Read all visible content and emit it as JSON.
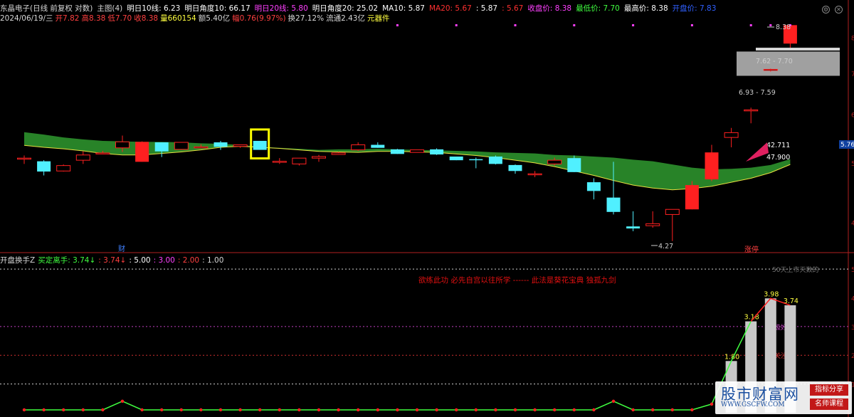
{
  "header": {
    "items": [
      {
        "text": "东晶电子(日线 前复权 对数)",
        "color": "#d8d8d8"
      },
      {
        "text": "主图(4)",
        "color": "#d8d8d8"
      },
      {
        "text": "明日10线: 6.23",
        "color": "#ffffff"
      },
      {
        "text": "明日角度10: 66.17",
        "color": "#ffffff"
      },
      {
        "text": "明日20线: 5.80",
        "color": "#ff40ff"
      },
      {
        "text": "明日角度20: 25.02",
        "color": "#ffffff"
      },
      {
        "text": "MA10: 5.87",
        "color": "#ffffff"
      },
      {
        "text": "MA20: 5.67",
        "color": "#ff3030"
      },
      {
        "text": ": 5.87",
        "color": "#ffffff"
      },
      {
        "text": ": 5.67",
        "color": "#ff3030"
      },
      {
        "text": "收盘价: 8.38",
        "color": "#ff40ff"
      },
      {
        "text": "最低价: 7.70",
        "color": "#40ff40"
      },
      {
        "text": "最高价: 8.38",
        "color": "#ffffff"
      },
      {
        "text": "开盘价: 7.83",
        "color": "#3060ff"
      }
    ],
    "line2": [
      {
        "text": "2024/06/19/三",
        "color": "#d8d8d8"
      },
      {
        "text": "开7.82",
        "color": "#ff4040"
      },
      {
        "text": "高8.38",
        "color": "#ff4040"
      },
      {
        "text": "低7.70",
        "color": "#ff4040"
      },
      {
        "text": "收8.38",
        "color": "#ff4040"
      },
      {
        "text": "量660154",
        "color": "#ffff40"
      },
      {
        "text": "额5.40亿",
        "color": "#d8d8d8"
      },
      {
        "text": "幅0.76(9.97%)",
        "color": "#ff4040"
      },
      {
        "text": "换27.12%",
        "color": "#d8d8d8"
      },
      {
        "text": "流通2.43亿",
        "color": "#d8d8d8"
      },
      {
        "text": "元器件",
        "color": "#ffff40"
      }
    ]
  },
  "indicator_header": [
    {
      "text": "开盘换手Z",
      "color": "#d8d8d8"
    },
    {
      "text": "买定离手: 3.74↓",
      "color": "#40ff40"
    },
    {
      "text": ": 3.74↓",
      "color": "#ff4040"
    },
    {
      "text": ": 5.00",
      "color": "#ffffff"
    },
    {
      "text": ": 3.00",
      "color": "#ff40ff"
    },
    {
      "text": ": 2.00",
      "color": "#ff4040"
    },
    {
      "text": ": 1.00",
      "color": "#d8d8d8"
    }
  ],
  "banner": "欲练此功 必先自宫以往所学 ------ 此法是葵花宝典 独孤九剑",
  "watermark": {
    "title": "股市财富网",
    "url": "WWW.GSCFW.COM",
    "tag1": "指标分享",
    "tag2": "名师课程"
  },
  "labels": {
    "cai": "财",
    "zhangting": "涨停",
    "low_price": "4.27",
    "high_price": "8.38",
    "range1": "6.93 - 7.59",
    "range2": "7.62 - 7.70",
    "val1": "42.711",
    "val2": "47.900",
    "price_tag": "5.76",
    "top_line": "50天上市天数的",
    "jihao": "极好",
    "guanzhu": "关注"
  },
  "colors": {
    "up": "#ff2020",
    "down": "#50f0ff",
    "band": "#2a8a2a",
    "zone": "#a0a0a0",
    "bar": "#c8c8c8",
    "line": "#40ff40",
    "dot": "#ff2020"
  },
  "chart_data": [
    {
      "type": "candlestick",
      "title": "东晶电子(日线 前复权 对数)",
      "ylim": [
        4,
        8.4
      ],
      "y_ticks": [
        4,
        5,
        6,
        7,
        8
      ],
      "candles": [
        {
          "o": 5.09,
          "h": 5.14,
          "l": 4.98,
          "c": 5.09
        },
        {
          "o": 5.03,
          "h": 5.05,
          "l": 4.77,
          "c": 4.84
        },
        {
          "o": 4.85,
          "h": 4.97,
          "l": 4.84,
          "c": 4.95
        },
        {
          "o": 5.05,
          "h": 5.22,
          "l": 4.98,
          "c": 5.15
        },
        {
          "o": 5.19,
          "h": 5.23,
          "l": 5.18,
          "c": 5.19
        },
        {
          "o": 5.29,
          "h": 5.54,
          "l": 5.21,
          "c": 5.41
        },
        {
          "o": 5.02,
          "h": 5.42,
          "l": 5.02,
          "c": 5.41
        },
        {
          "o": 5.4,
          "h": 5.4,
          "l": 5.11,
          "c": 5.22
        },
        {
          "o": 5.26,
          "h": 5.4,
          "l": 5.25,
          "c": 5.4
        },
        {
          "o": 5.31,
          "h": 5.36,
          "l": 5.28,
          "c": 5.31
        },
        {
          "o": 5.4,
          "h": 5.43,
          "l": 5.25,
          "c": 5.31
        },
        {
          "o": 5.32,
          "h": 5.35,
          "l": 5.29,
          "c": 5.35
        },
        {
          "o": 5.43,
          "h": 5.43,
          "l": 5.25,
          "c": 5.25
        },
        {
          "o": 5.03,
          "h": 5.09,
          "l": 4.98,
          "c": 5.03
        },
        {
          "o": 4.98,
          "h": 5.09,
          "l": 4.95,
          "c": 5.09
        },
        {
          "o": 5.09,
          "h": 5.15,
          "l": 5.02,
          "c": 5.12
        },
        {
          "o": 5.16,
          "h": 5.21,
          "l": 5.16,
          "c": 5.19
        },
        {
          "o": 5.25,
          "h": 5.4,
          "l": 5.23,
          "c": 5.35
        },
        {
          "o": 5.35,
          "h": 5.4,
          "l": 5.29,
          "c": 5.29
        },
        {
          "o": 5.26,
          "h": 5.27,
          "l": 5.17,
          "c": 5.17
        },
        {
          "o": 5.2,
          "h": 5.25,
          "l": 5.2,
          "c": 5.25
        },
        {
          "o": 5.26,
          "h": 5.28,
          "l": 5.15,
          "c": 5.16
        },
        {
          "o": 5.12,
          "h": 5.12,
          "l": 5.05,
          "c": 5.05
        },
        {
          "o": 5.07,
          "h": 5.1,
          "l": 4.9,
          "c": 5.05
        },
        {
          "o": 5.12,
          "h": 5.14,
          "l": 4.97,
          "c": 4.98
        },
        {
          "o": 4.96,
          "h": 4.97,
          "l": 4.8,
          "c": 4.85
        },
        {
          "o": 4.79,
          "h": 4.85,
          "l": 4.74,
          "c": 4.8
        },
        {
          "o": 4.98,
          "h": 5.1,
          "l": 4.95,
          "c": 5.05
        },
        {
          "o": 5.09,
          "h": 5.14,
          "l": 4.83,
          "c": 4.83
        },
        {
          "o": 4.65,
          "h": 4.72,
          "l": 4.36,
          "c": 4.5
        },
        {
          "o": 4.39,
          "h": 5.02,
          "l": 4.12,
          "c": 4.16
        },
        {
          "o": 3.94,
          "h": 4.17,
          "l": 3.87,
          "c": 3.91
        },
        {
          "o": 3.95,
          "h": 4.17,
          "l": 3.92,
          "c": 3.98
        },
        {
          "o": 4.12,
          "h": 4.16,
          "l": 3.73,
          "c": 4.2
        },
        {
          "o": 4.2,
          "h": 4.67,
          "l": 4.2,
          "c": 4.6
        },
        {
          "o": 4.7,
          "h": 5.35,
          "l": 4.67,
          "c": 5.2
        },
        {
          "o": 5.5,
          "h": 5.7,
          "l": 5.3,
          "c": 5.6
        },
        {
          "o": 6.1,
          "h": 6.15,
          "l": 5.8,
          "c": 6.1
        },
        {
          "o": 7.08,
          "h": 7.12,
          "l": 7.04,
          "c": 7.1
        },
        {
          "o": 7.82,
          "h": 8.38,
          "l": 7.7,
          "c": 8.38
        }
      ],
      "band_upper": [
        5.61,
        5.56,
        5.5,
        5.46,
        5.43,
        5.42,
        5.41,
        5.41,
        5.4,
        5.38,
        5.37,
        5.35,
        5.31,
        5.29,
        5.27,
        5.25,
        5.26,
        5.26,
        5.27,
        5.26,
        5.25,
        5.24,
        5.23,
        5.22,
        5.2,
        5.19,
        5.18,
        5.15,
        5.14,
        5.12,
        5.1,
        5.06,
        5.03,
        4.97,
        4.91,
        4.88,
        4.89,
        4.91,
        4.96,
        5.07
      ],
      "band_lower": [
        5.34,
        5.3,
        5.27,
        5.23,
        5.18,
        5.15,
        5.15,
        5.18,
        5.21,
        5.25,
        5.3,
        5.32,
        5.3,
        5.28,
        5.25,
        5.22,
        5.21,
        5.2,
        5.22,
        5.22,
        5.21,
        5.2,
        5.17,
        5.14,
        5.1,
        5.05,
        5.0,
        4.93,
        4.85,
        4.77,
        4.68,
        4.6,
        4.55,
        4.52,
        4.54,
        4.58,
        4.65,
        4.72,
        4.82,
        4.97
      ],
      "top_dots": [
        19,
        22,
        25,
        28,
        31,
        34,
        37,
        38,
        39
      ],
      "highlight_index": 12,
      "zone_1": [
        6.93,
        7.59
      ],
      "zone_2": [
        7.62,
        7.7
      ]
    },
    {
      "type": "bar+line",
      "ylim": [
        0,
        5.2
      ],
      "y_ticks": [
        1,
        2,
        3,
        4,
        5
      ],
      "ref_lines": [
        {
          "value": 5.0,
          "color": "#d0d0d0"
        },
        {
          "value": 3.0,
          "color": "#c040c0"
        },
        {
          "value": 2.0,
          "color": "#d03030"
        },
        {
          "value": 1.0,
          "color": "#d0d0d0"
        }
      ],
      "bars": [
        {
          "index": 36,
          "value": 1.8
        },
        {
          "index": 37,
          "value": 3.18
        },
        {
          "index": 38,
          "value": 3.98
        },
        {
          "index": 39,
          "value": 3.74
        }
      ],
      "line": [
        0.1,
        0.1,
        0.1,
        0.1,
        0.1,
        0.4,
        0.1,
        0.1,
        0.1,
        0.1,
        0.1,
        0.1,
        0.1,
        0.1,
        0.1,
        0.1,
        0.1,
        0.1,
        0.1,
        0.1,
        0.1,
        0.1,
        0.1,
        0.1,
        0.1,
        0.1,
        0.1,
        0.1,
        0.1,
        0.1,
        0.4,
        0.1,
        0.1,
        0.1,
        0.1,
        0.3,
        1.8,
        3.18,
        3.98,
        3.74
      ]
    }
  ]
}
